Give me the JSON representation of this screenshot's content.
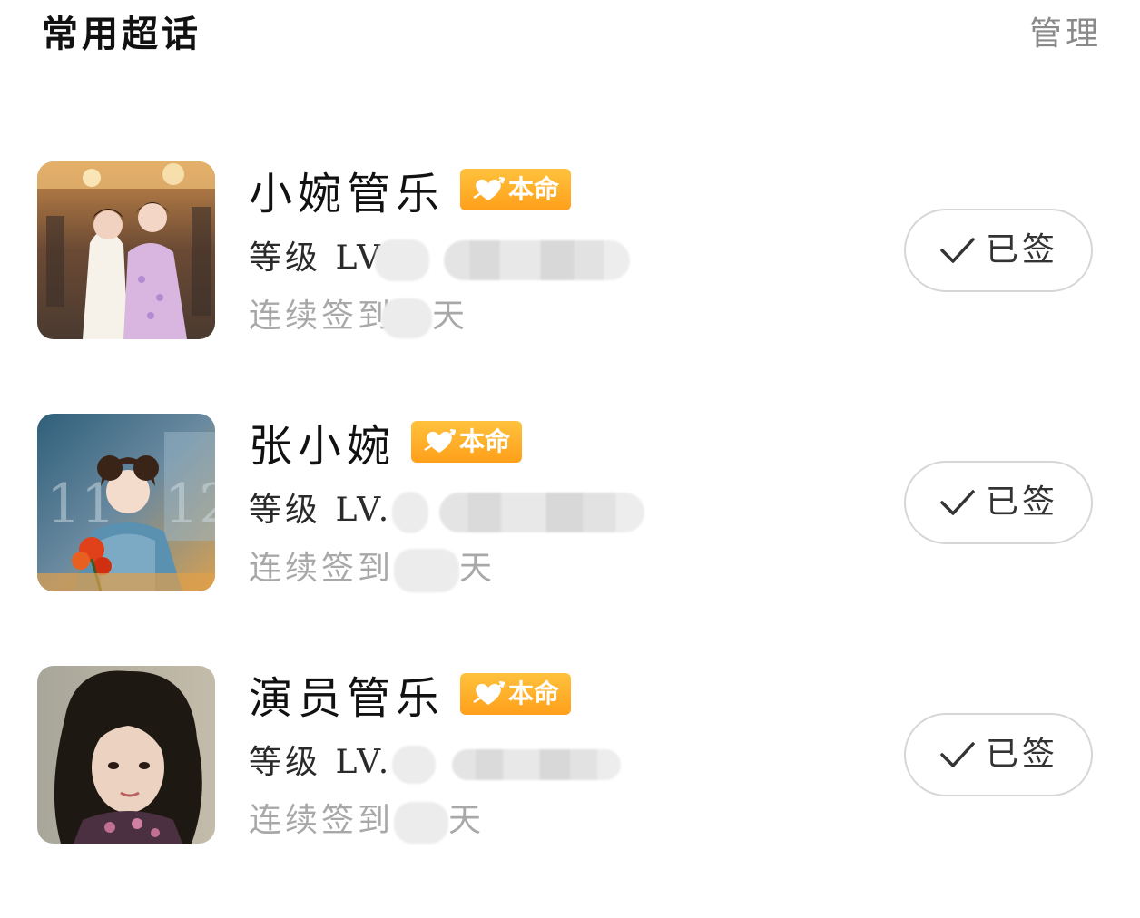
{
  "header": {
    "title": "常用超话",
    "manage_label": "管理"
  },
  "topics": [
    {
      "name": "小婉管乐",
      "badge": "本命",
      "level_prefix": "等级 LV",
      "streak_prefix": "连续签到",
      "streak_suffix": "天",
      "signed_label": "已签"
    },
    {
      "name": "张小婉",
      "badge": "本命",
      "level_prefix": "等级 LV.",
      "streak_prefix": "连续签到",
      "streak_suffix": "天",
      "signed_label": "已签"
    },
    {
      "name": "演员管乐",
      "badge": "本命",
      "level_prefix": "等级 LV.",
      "streak_prefix": "连续签到",
      "streak_suffix": "天",
      "signed_label": "已签"
    }
  ],
  "colors": {
    "badge_gradient_top": "#ffc23d",
    "badge_gradient_bottom": "#ff9f1a",
    "muted_text": "#a8a8a8",
    "manage_text": "#8a8a8a",
    "button_border": "#d6d6d6"
  }
}
